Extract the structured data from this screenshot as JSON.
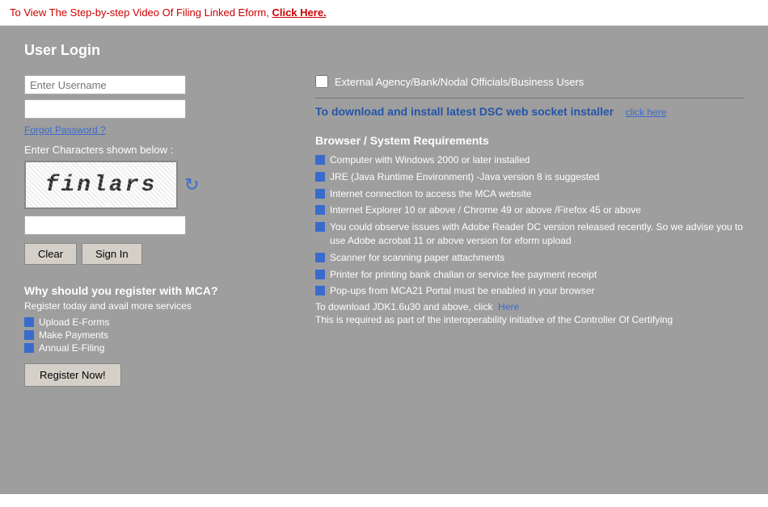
{
  "topbar": {
    "message": "To View The Step-by-step Video Of Filing Linked Eform,",
    "link_text": "Click Here."
  },
  "login": {
    "title": "User Login",
    "username_placeholder": "Enter Username",
    "external_label": "External Agency/Bank/Nodal Officials/Business Users",
    "forgot_password": "Forgot Password ?",
    "captcha_label": "Enter Characters shown below :",
    "captcha_text": "finlars",
    "clear_btn": "Clear",
    "signin_btn": "Sign In"
  },
  "dsc": {
    "text": "To download and install latest DSC web socket installer",
    "link": "click here"
  },
  "register": {
    "heading": "Why should you register with MCA?",
    "subtext": "Register today and avail more services",
    "items": [
      "Upload E-Forms",
      "Make Payments",
      "Annual E-Filing"
    ],
    "button": "Register Now!"
  },
  "browser": {
    "heading": "Browser / System Requirements",
    "items": [
      "Computer with Windows 2000 or later installed",
      "JRE (Java Runtime Environment) -Java version 8 is suggested",
      "Internet connection to access the MCA website",
      "Internet Explorer 10 or above / Chrome 49 or above /Firefox 45 or above",
      "You could observe issues with Adobe Reader DC version released recently. So we advise you to use Adobe acrobat 11 or above version for eform upload",
      "Scanner for scanning paper attachments",
      "Printer for printing bank challan or service fee payment receipt",
      "Pop-ups from MCA21 Portal must be enabled in your browser"
    ],
    "download_text": "To download JDK1.6u30 and above, click",
    "download_link": "Here",
    "interop_text": "This is required as part of the interoperability initiative of the Controller Of Certifying"
  }
}
